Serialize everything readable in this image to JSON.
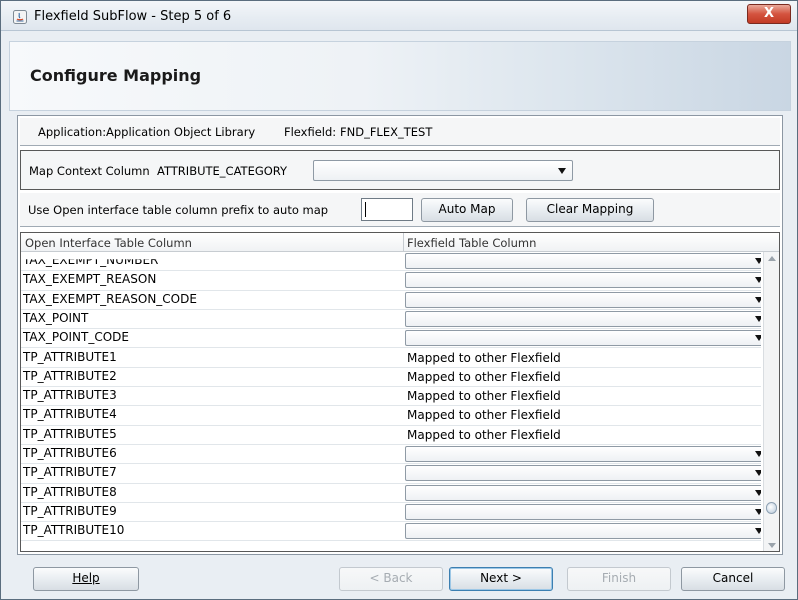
{
  "window": {
    "title": "Flexfield SubFlow - Step 5 of 6",
    "close_label": "X"
  },
  "header": {
    "title": "Configure Mapping"
  },
  "info": {
    "application_label": "Application:",
    "application_value": "Application Object Library",
    "flexfield_label": "Flexfield:",
    "flexfield_value": "FND_FLEX_TEST"
  },
  "context": {
    "label": "Map Context Column",
    "column": "ATTRIBUTE_CATEGORY",
    "selected": ""
  },
  "automap": {
    "label": "Use Open interface table column prefix to auto map",
    "prefix_value": "",
    "auto_map_label": "Auto Map",
    "clear_mapping_label": "Clear Mapping"
  },
  "table": {
    "headers": [
      "Open Interface Table Column",
      "Flexfield Table Column"
    ],
    "rows": [
      {
        "column": "TAX_EXEMPT_NUMBER",
        "mapping": ""
      },
      {
        "column": "TAX_EXEMPT_REASON",
        "mapping": ""
      },
      {
        "column": "TAX_EXEMPT_REASON_CODE",
        "mapping": ""
      },
      {
        "column": "TAX_POINT",
        "mapping": ""
      },
      {
        "column": "TAX_POINT_CODE",
        "mapping": ""
      },
      {
        "column": "TP_ATTRIBUTE1",
        "mapping": "Mapped to other Flexfield"
      },
      {
        "column": "TP_ATTRIBUTE2",
        "mapping": "Mapped to other Flexfield"
      },
      {
        "column": "TP_ATTRIBUTE3",
        "mapping": "Mapped to other Flexfield"
      },
      {
        "column": "TP_ATTRIBUTE4",
        "mapping": "Mapped to other Flexfield"
      },
      {
        "column": "TP_ATTRIBUTE5",
        "mapping": "Mapped to other Flexfield"
      },
      {
        "column": "TP_ATTRIBUTE6",
        "mapping": ""
      },
      {
        "column": "TP_ATTRIBUTE7",
        "mapping": ""
      },
      {
        "column": "TP_ATTRIBUTE8",
        "mapping": ""
      },
      {
        "column": "TP_ATTRIBUTE9",
        "mapping": ""
      },
      {
        "column": "TP_ATTRIBUTE10",
        "mapping": ""
      }
    ]
  },
  "footer": {
    "help_label": "Help",
    "back_label": "< Back",
    "next_label": "Next >",
    "finish_label": "Finish",
    "cancel_label": "Cancel"
  },
  "colors": {
    "close_button": "#c23b25",
    "focus_ring": "#3c7fb1",
    "panel_border": "#585858"
  }
}
